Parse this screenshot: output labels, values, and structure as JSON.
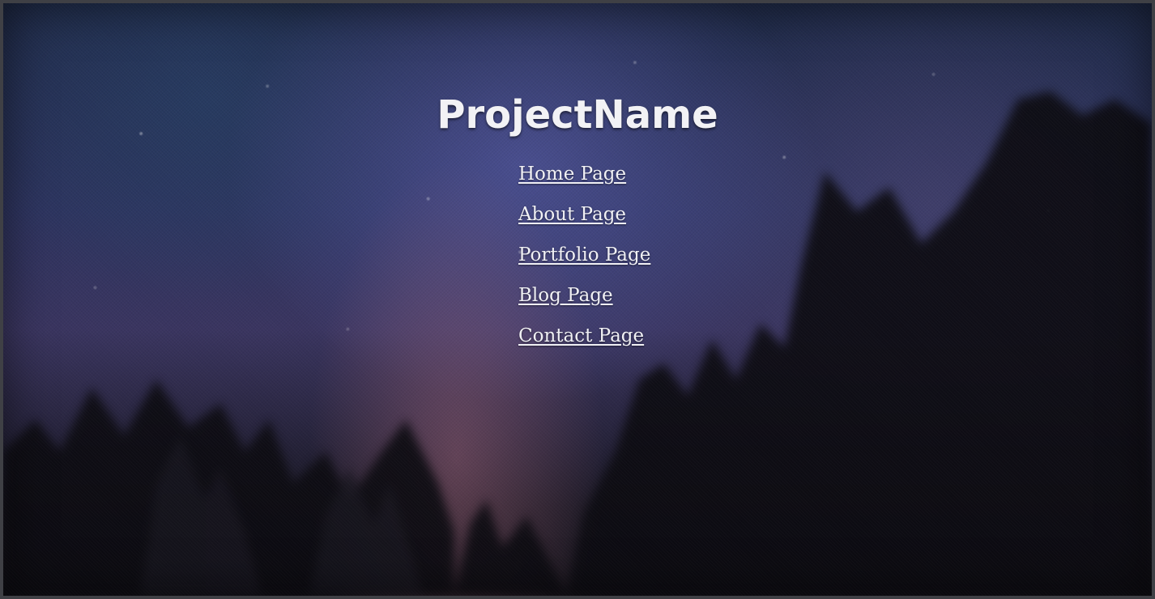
{
  "site": {
    "title": "ProjectName"
  },
  "nav": {
    "items": [
      {
        "label": "Home Page"
      },
      {
        "label": "About Page"
      },
      {
        "label": "Portfolio Page"
      },
      {
        "label": "Blog Page"
      },
      {
        "label": "Contact Page"
      }
    ]
  },
  "colors": {
    "text": "#f2f2f5",
    "sky_top": "#1f2a48",
    "sky_mid": "#3a3560",
    "tree_silhouette": "#0d0c12"
  }
}
